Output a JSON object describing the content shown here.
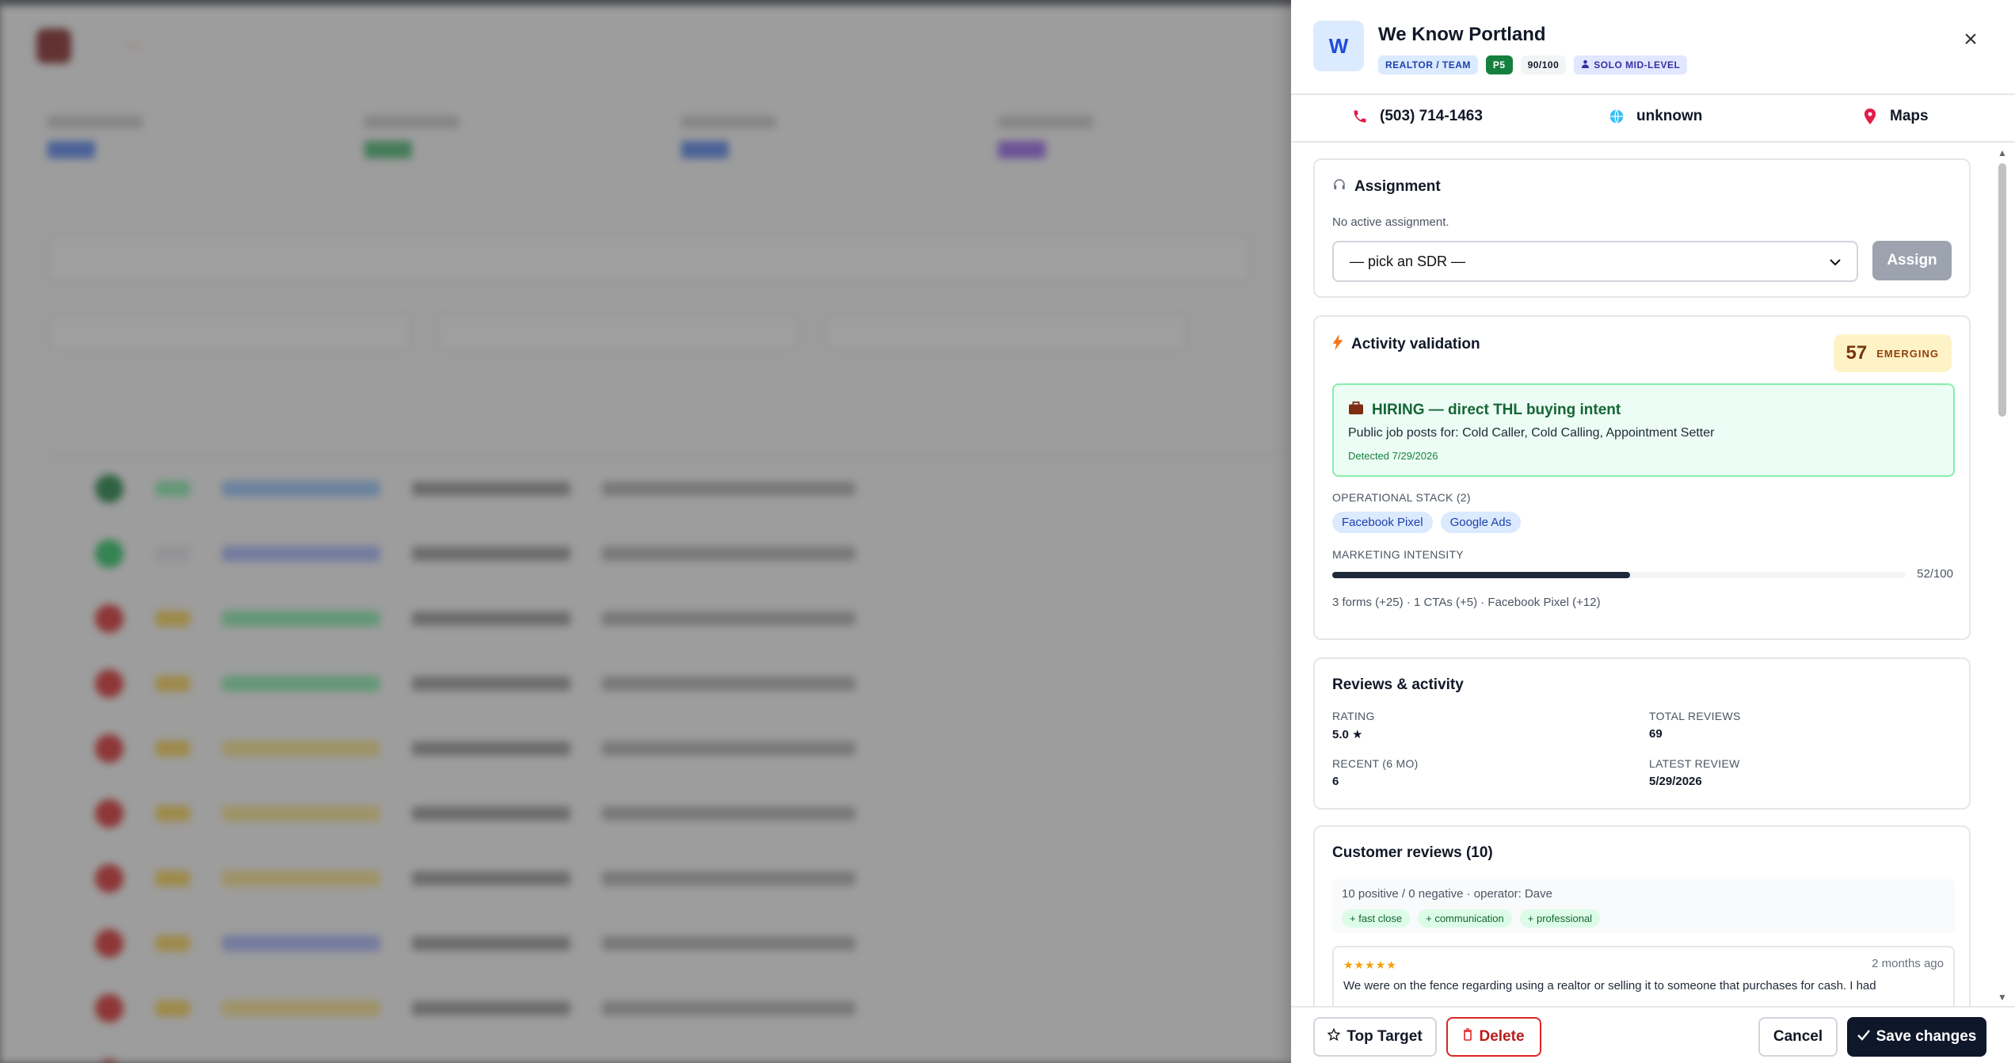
{
  "panel": {
    "avatar_letter": "W",
    "company_name": "We Know Portland",
    "badges": {
      "type": "REALTOR / TEAM",
      "priority": "P5",
      "score": "90/100",
      "solo": "SOLO MID-LEVEL"
    },
    "close_glyph": "×",
    "contact": {
      "phone": "(503) 714-1463",
      "website": "unknown",
      "maps": "Maps"
    },
    "assignment": {
      "title": "Assignment",
      "status": "No active assignment.",
      "select_value": "— pick an SDR —",
      "assign_label": "Assign"
    },
    "activity": {
      "title": "Activity validation",
      "score": "57",
      "score_label": "EMERGING",
      "hiring_title": "HIRING — direct THL buying intent",
      "hiring_posts": "Public job posts for: Cold Caller, Cold Calling, Appointment Setter",
      "hiring_detected": "Detected 7/29/2026",
      "stack_label": "OPERATIONAL STACK (2)",
      "stack": [
        "Facebook Pixel",
        "Google Ads"
      ],
      "intensity_label": "MARKETING INTENSITY",
      "intensity_value": "52/100",
      "intensity_fraction": 0.52,
      "intensity_detail": "3 forms (+25) · 1 CTAs (+5) · Facebook Pixel (+12)"
    },
    "reviews_activity": {
      "title": "Reviews & activity",
      "rating_label": "RATING",
      "rating_value": "5.0 ★",
      "total_label": "TOTAL REVIEWS",
      "total_value": "69",
      "recent_label": "RECENT (6 MO)",
      "recent_value": "6",
      "latest_label": "LATEST REVIEW",
      "latest_value": "5/29/2026"
    },
    "customer_reviews": {
      "title": "Customer reviews (10)",
      "summary": "10 positive / 0 negative · operator: Dave",
      "tags": [
        "+ fast close",
        "+ communication",
        "+ professional"
      ],
      "first_review": {
        "stars": "★★★★★",
        "when": "2 months ago",
        "text": "We were on the fence regarding using a realtor or selling it to someone that purchases for cash. I had"
      }
    },
    "footer": {
      "top_target": "Top Target",
      "delete": "Delete",
      "cancel": "Cancel",
      "save": "Save changes"
    }
  },
  "icons": {
    "phone": "phone-icon",
    "globe": "globe-icon",
    "pin": "map-pin-icon",
    "headset": "headset-icon",
    "bolt": "bolt-icon",
    "briefcase": "briefcase-icon",
    "star": "star-icon",
    "trash": "trash-icon",
    "check": "check-icon",
    "person": "person-icon"
  },
  "colors": {
    "accent_dark": "#0f172a",
    "priority_green": "#15803d",
    "delete_red": "#dc2626",
    "emerging_bg": "#fef3c7"
  }
}
